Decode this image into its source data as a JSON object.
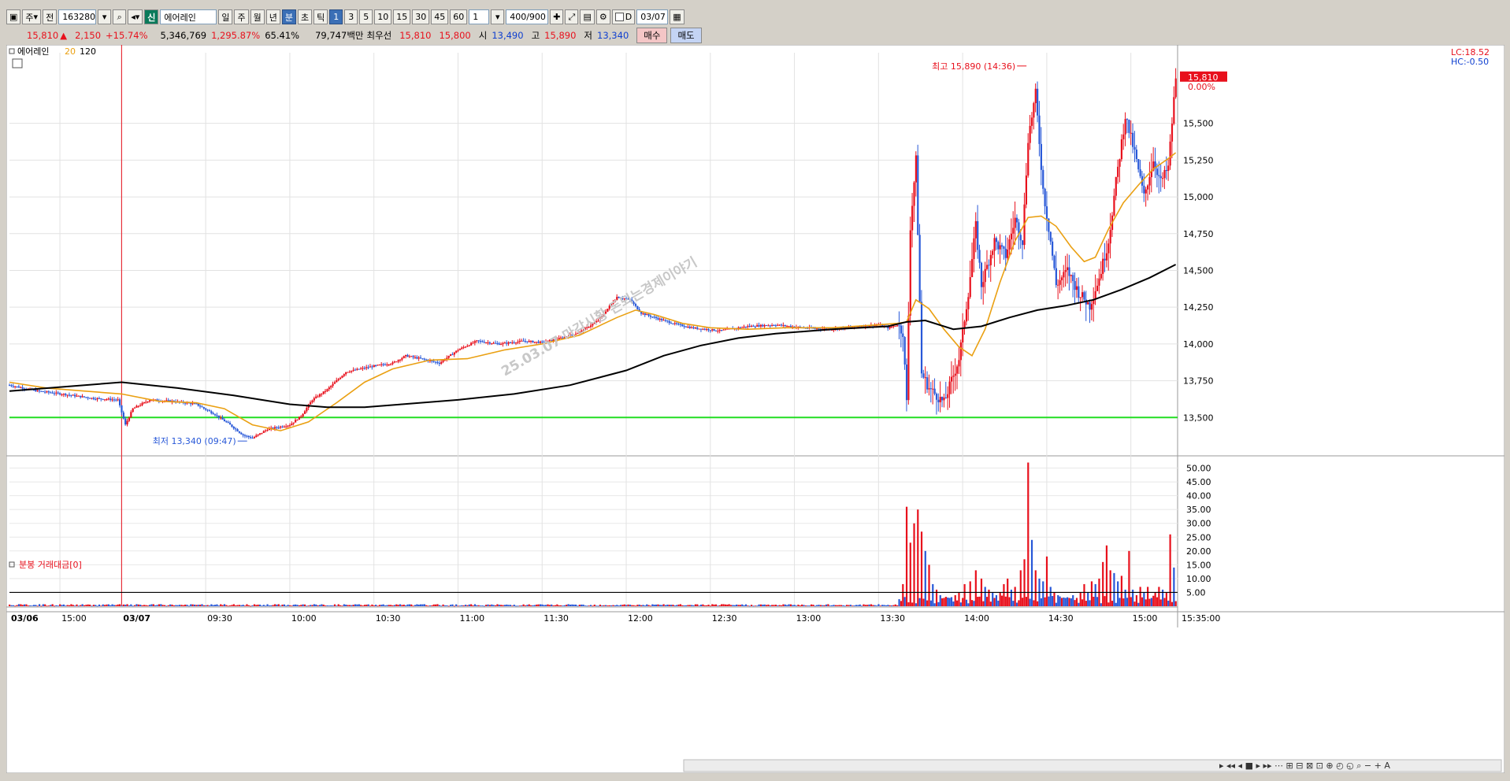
{
  "toolbar": {
    "market_label": "주",
    "prev_label": "전",
    "stock_code": "163280",
    "new_badge": "신",
    "stock_name": "에어레인",
    "period_day": "일",
    "period_week": "주",
    "period_month": "월",
    "period_year": "년",
    "period_min": "분",
    "period_sec": "초",
    "period_tick": "틱",
    "intervals": [
      "1",
      "3",
      "5",
      "10",
      "15",
      "30",
      "45",
      "60"
    ],
    "custom_interval": "1",
    "count": "400/900",
    "date_check_label": "D",
    "date": "03/07"
  },
  "info": {
    "price": "15,810",
    "change": "2,150",
    "change_pct": "+15.74%",
    "volume": "5,346,769",
    "volume_ratio": "1,295.87%",
    "rate": "65.41%",
    "amount": "79,747백만",
    "best_label": "최우선",
    "best_ask": "15,810",
    "best_bid": "15,800",
    "open_label": "시",
    "open": "13,490",
    "high_label": "고",
    "high": "15,890",
    "low_label": "저",
    "low": "13,340",
    "buy_button": "매수",
    "sell_button": "매도"
  },
  "colors": {
    "up": "#e8101c",
    "down": "#2858d8",
    "ma20": "#eaa012",
    "ma120": "#000000",
    "support_line": "#22dd22",
    "price_tag": "#e8101c"
  },
  "chart_data": {
    "type": "candlestick",
    "title": "에어레인",
    "ma_periods": [
      20,
      120
    ],
    "legend": [
      "에어레인",
      "20",
      "120"
    ],
    "lc_label": "LC:18.52",
    "hc_label": "HC:-0.50",
    "last_price_tag": "15,810",
    "last_pct_tag": "0.00%",
    "price_ticks": [
      "13,500",
      "13,750",
      "14,000",
      "14,250",
      "14,500",
      "14,750",
      "15,000",
      "15,250",
      "15,500"
    ],
    "price_range": [
      13250,
      15980
    ],
    "support_level": 13500,
    "high_annotation": "최고 15,890 (14:36)",
    "low_annotation": "최저 13,340 (09:47)",
    "watermark": "25.03.07 마감시황 돈되는경제이야기",
    "time_labels": [
      {
        "t": 0,
        "label": "03/06"
      },
      {
        "t": 27,
        "label": "15:00"
      },
      {
        "t": 60,
        "label": "03/07"
      },
      {
        "t": 105,
        "label": "09:30"
      },
      {
        "t": 150,
        "label": "10:00"
      },
      {
        "t": 195,
        "label": "10:30"
      },
      {
        "t": 240,
        "label": "11:00"
      },
      {
        "t": 285,
        "label": "11:30"
      },
      {
        "t": 330,
        "label": "12:00"
      },
      {
        "t": 375,
        "label": "12:30"
      },
      {
        "t": 420,
        "label": "13:00"
      },
      {
        "t": 465,
        "label": "13:30"
      },
      {
        "t": 510,
        "label": "14:00"
      },
      {
        "t": 555,
        "label": "14:30"
      },
      {
        "t": 600,
        "label": "15:00"
      },
      {
        "t": 644,
        "label": "15:35:00"
      }
    ],
    "day_divider_t": 60,
    "total_bars": 625,
    "price_path": [
      [
        0,
        13720
      ],
      [
        15,
        13680
      ],
      [
        28,
        13660
      ],
      [
        45,
        13630
      ],
      [
        58,
        13620
      ],
      [
        62,
        13450
      ],
      [
        66,
        13560
      ],
      [
        75,
        13620
      ],
      [
        88,
        13610
      ],
      [
        100,
        13590
      ],
      [
        110,
        13520
      ],
      [
        118,
        13450
      ],
      [
        125,
        13380
      ],
      [
        130,
        13360
      ],
      [
        138,
        13420
      ],
      [
        150,
        13450
      ],
      [
        156,
        13510
      ],
      [
        162,
        13620
      ],
      [
        170,
        13690
      ],
      [
        180,
        13810
      ],
      [
        195,
        13850
      ],
      [
        205,
        13870
      ],
      [
        212,
        13920
      ],
      [
        220,
        13900
      ],
      [
        230,
        13870
      ],
      [
        240,
        13960
      ],
      [
        250,
        14020
      ],
      [
        262,
        14000
      ],
      [
        275,
        14020
      ],
      [
        285,
        14010
      ],
      [
        295,
        14040
      ],
      [
        305,
        14080
      ],
      [
        315,
        14160
      ],
      [
        325,
        14320
      ],
      [
        332,
        14300
      ],
      [
        338,
        14210
      ],
      [
        345,
        14180
      ],
      [
        355,
        14140
      ],
      [
        365,
        14110
      ],
      [
        380,
        14090
      ],
      [
        395,
        14120
      ],
      [
        410,
        14130
      ],
      [
        425,
        14110
      ],
      [
        440,
        14100
      ],
      [
        455,
        14120
      ],
      [
        465,
        14130
      ],
      [
        470,
        14110
      ],
      [
        475,
        14130
      ],
      [
        478,
        14080
      ],
      [
        480,
        13600
      ],
      [
        482,
        14800
      ],
      [
        485,
        15250
      ],
      [
        488,
        13800
      ],
      [
        492,
        13700
      ],
      [
        500,
        13600
      ],
      [
        508,
        13900
      ],
      [
        513,
        14350
      ],
      [
        517,
        14800
      ],
      [
        520,
        14400
      ],
      [
        527,
        14700
      ],
      [
        533,
        14600
      ],
      [
        538,
        14850
      ],
      [
        542,
        14700
      ],
      [
        545,
        15400
      ],
      [
        549,
        15700
      ],
      [
        553,
        15050
      ],
      [
        557,
        14700
      ],
      [
        560,
        14400
      ],
      [
        566,
        14500
      ],
      [
        572,
        14350
      ],
      [
        578,
        14260
      ],
      [
        583,
        14450
      ],
      [
        588,
        14700
      ],
      [
        592,
        15100
      ],
      [
        597,
        15550
      ],
      [
        602,
        15300
      ],
      [
        607,
        15000
      ],
      [
        612,
        15250
      ],
      [
        616,
        15100
      ],
      [
        620,
        15200
      ],
      [
        624,
        15810
      ]
    ],
    "ma20_path": [
      [
        0,
        13740
      ],
      [
        20,
        13700
      ],
      [
        40,
        13680
      ],
      [
        60,
        13660
      ],
      [
        80,
        13610
      ],
      [
        100,
        13600
      ],
      [
        115,
        13560
      ],
      [
        130,
        13450
      ],
      [
        145,
        13410
      ],
      [
        160,
        13470
      ],
      [
        175,
        13600
      ],
      [
        190,
        13740
      ],
      [
        205,
        13830
      ],
      [
        225,
        13890
      ],
      [
        245,
        13900
      ],
      [
        265,
        13960
      ],
      [
        285,
        14000
      ],
      [
        305,
        14060
      ],
      [
        325,
        14180
      ],
      [
        335,
        14230
      ],
      [
        345,
        14200
      ],
      [
        360,
        14140
      ],
      [
        375,
        14110
      ],
      [
        395,
        14100
      ],
      [
        415,
        14110
      ],
      [
        440,
        14110
      ],
      [
        465,
        14130
      ],
      [
        475,
        14140
      ],
      [
        480,
        14150
      ],
      [
        485,
        14300
      ],
      [
        492,
        14240
      ],
      [
        500,
        14100
      ],
      [
        508,
        13980
      ],
      [
        515,
        13920
      ],
      [
        522,
        14100
      ],
      [
        530,
        14420
      ],
      [
        538,
        14700
      ],
      [
        545,
        14860
      ],
      [
        552,
        14870
      ],
      [
        560,
        14800
      ],
      [
        568,
        14660
      ],
      [
        575,
        14560
      ],
      [
        581,
        14590
      ],
      [
        588,
        14780
      ],
      [
        596,
        14960
      ],
      [
        604,
        15080
      ],
      [
        612,
        15190
      ],
      [
        620,
        15260
      ],
      [
        624,
        15300
      ]
    ],
    "ma120_path": [
      [
        0,
        13680
      ],
      [
        30,
        13710
      ],
      [
        60,
        13740
      ],
      [
        90,
        13700
      ],
      [
        120,
        13650
      ],
      [
        150,
        13590
      ],
      [
        170,
        13570
      ],
      [
        190,
        13570
      ],
      [
        210,
        13590
      ],
      [
        240,
        13620
      ],
      [
        270,
        13660
      ],
      [
        300,
        13720
      ],
      [
        330,
        13820
      ],
      [
        350,
        13920
      ],
      [
        370,
        13990
      ],
      [
        390,
        14040
      ],
      [
        410,
        14070
      ],
      [
        440,
        14100
      ],
      [
        470,
        14120
      ],
      [
        480,
        14150
      ],
      [
        490,
        14160
      ],
      [
        505,
        14100
      ],
      [
        520,
        14120
      ],
      [
        535,
        14180
      ],
      [
        550,
        14230
      ],
      [
        565,
        14260
      ],
      [
        580,
        14300
      ],
      [
        595,
        14370
      ],
      [
        610,
        14450
      ],
      [
        624,
        14540
      ]
    ],
    "volume": {
      "title": "분봉 거래대금[0]",
      "y_ticks": [
        "5.00",
        "10.00",
        "15.00",
        "20.00",
        "25.00",
        "30.00",
        "35.00",
        "40.00",
        "45.00",
        "50.00"
      ],
      "y_range": [
        0,
        53
      ],
      "reference_level": 5,
      "spikes": [
        {
          "t": 478,
          "v": 8,
          "up": true
        },
        {
          "t": 480,
          "v": 36,
          "up": true
        },
        {
          "t": 482,
          "v": 23,
          "up": true
        },
        {
          "t": 484,
          "v": 30,
          "up": true
        },
        {
          "t": 486,
          "v": 35,
          "up": true
        },
        {
          "t": 488,
          "v": 27,
          "up": true
        },
        {
          "t": 490,
          "v": 20,
          "up": false
        },
        {
          "t": 492,
          "v": 15,
          "up": true
        },
        {
          "t": 494,
          "v": 8,
          "up": false
        },
        {
          "t": 496,
          "v": 6,
          "up": true
        },
        {
          "t": 498,
          "v": 4,
          "up": false
        },
        {
          "t": 500,
          "v": 3,
          "up": true
        },
        {
          "t": 503,
          "v": 3,
          "up": false
        },
        {
          "t": 506,
          "v": 4,
          "up": true
        },
        {
          "t": 508,
          "v": 5,
          "up": true
        },
        {
          "t": 511,
          "v": 8,
          "up": true
        },
        {
          "t": 514,
          "v": 9,
          "up": true
        },
        {
          "t": 517,
          "v": 13,
          "up": true
        },
        {
          "t": 520,
          "v": 10,
          "up": true
        },
        {
          "t": 522,
          "v": 7,
          "up": false
        },
        {
          "t": 524,
          "v": 6,
          "up": true
        },
        {
          "t": 526,
          "v": 5,
          "up": false
        },
        {
          "t": 528,
          "v": 4,
          "up": false
        },
        {
          "t": 530,
          "v": 5,
          "up": true
        },
        {
          "t": 532,
          "v": 8,
          "up": true
        },
        {
          "t": 534,
          "v": 10,
          "up": true
        },
        {
          "t": 536,
          "v": 6,
          "up": false
        },
        {
          "t": 538,
          "v": 7,
          "up": true
        },
        {
          "t": 541,
          "v": 13,
          "up": true
        },
        {
          "t": 543,
          "v": 17,
          "up": true
        },
        {
          "t": 545,
          "v": 52,
          "up": true
        },
        {
          "t": 547,
          "v": 24,
          "up": false
        },
        {
          "t": 549,
          "v": 13,
          "up": true
        },
        {
          "t": 551,
          "v": 10,
          "up": false
        },
        {
          "t": 553,
          "v": 9,
          "up": false
        },
        {
          "t": 555,
          "v": 18,
          "up": true
        },
        {
          "t": 557,
          "v": 7,
          "up": false
        },
        {
          "t": 559,
          "v": 5,
          "up": true
        },
        {
          "t": 561,
          "v": 4,
          "up": false
        },
        {
          "t": 563,
          "v": 3,
          "up": true
        },
        {
          "t": 565,
          "v": 3,
          "up": false
        },
        {
          "t": 567,
          "v": 3,
          "up": true
        },
        {
          "t": 569,
          "v": 4,
          "up": false
        },
        {
          "t": 571,
          "v": 3,
          "up": true
        },
        {
          "t": 573,
          "v": 5,
          "up": true
        },
        {
          "t": 575,
          "v": 8,
          "up": true
        },
        {
          "t": 577,
          "v": 5,
          "up": false
        },
        {
          "t": 579,
          "v": 9,
          "up": true
        },
        {
          "t": 581,
          "v": 8,
          "up": false
        },
        {
          "t": 583,
          "v": 10,
          "up": true
        },
        {
          "t": 585,
          "v": 16,
          "up": true
        },
        {
          "t": 587,
          "v": 22,
          "up": true
        },
        {
          "t": 589,
          "v": 13,
          "up": true
        },
        {
          "t": 591,
          "v": 12,
          "up": false
        },
        {
          "t": 593,
          "v": 9,
          "up": false
        },
        {
          "t": 595,
          "v": 11,
          "up": true
        },
        {
          "t": 597,
          "v": 6,
          "up": false
        },
        {
          "t": 599,
          "v": 20,
          "up": true
        },
        {
          "t": 601,
          "v": 6,
          "up": false
        },
        {
          "t": 603,
          "v": 4,
          "up": true
        },
        {
          "t": 605,
          "v": 7,
          "up": true
        },
        {
          "t": 607,
          "v": 5,
          "up": false
        },
        {
          "t": 609,
          "v": 7,
          "up": true
        },
        {
          "t": 611,
          "v": 3,
          "up": false
        },
        {
          "t": 613,
          "v": 5,
          "up": true
        },
        {
          "t": 615,
          "v": 7,
          "up": true
        },
        {
          "t": 617,
          "v": 6,
          "up": false
        },
        {
          "t": 619,
          "v": 5,
          "up": true
        },
        {
          "t": 621,
          "v": 26,
          "up": true
        },
        {
          "t": 623,
          "v": 14,
          "up": false
        },
        {
          "t": 625,
          "v": 4,
          "up": false
        }
      ]
    }
  }
}
